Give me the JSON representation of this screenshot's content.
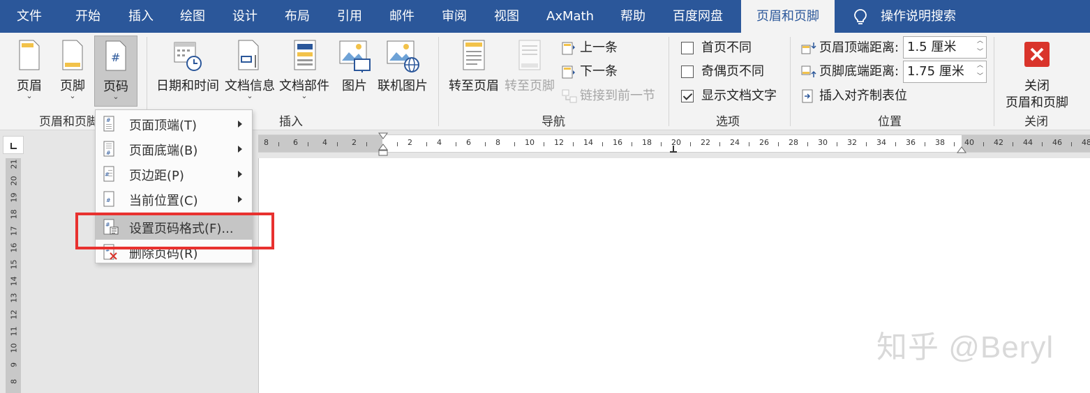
{
  "tabs": [
    {
      "label": "文件"
    },
    {
      "label": "开始"
    },
    {
      "label": "插入"
    },
    {
      "label": "绘图"
    },
    {
      "label": "设计"
    },
    {
      "label": "布局"
    },
    {
      "label": "引用"
    },
    {
      "label": "邮件"
    },
    {
      "label": "审阅"
    },
    {
      "label": "视图"
    },
    {
      "label": "AxMath"
    },
    {
      "label": "帮助"
    },
    {
      "label": "百度网盘"
    },
    {
      "label": "页眉和页脚"
    }
  ],
  "search": {
    "label": "操作说明搜索",
    "icon": "lightbulb-icon"
  },
  "ribbon": {
    "group_hf": {
      "label": "页眉和页脚",
      "header_btn": "页眉",
      "footer_btn": "页脚",
      "pagenum_btn": "页码",
      "pagenum_icon_text": "#"
    },
    "group_insert": {
      "label": "插入",
      "datetime": "日期和时间",
      "docinfo": "文档信息",
      "docparts": "文档部件",
      "picture": "图片",
      "onlinepic": "联机图片"
    },
    "group_nav": {
      "label": "导航",
      "goto_header": "转至页眉",
      "goto_footer": "转至页脚",
      "prev": "上一条",
      "next": "下一条",
      "link_prev": "链接到前一节"
    },
    "group_options": {
      "label": "选项",
      "diff_first": "首页不同",
      "diff_first_checked": false,
      "diff_oddeven": "奇偶页不同",
      "diff_oddeven_checked": false,
      "show_doc_text": "显示文档文字",
      "show_doc_text_checked": true
    },
    "group_position": {
      "label": "位置",
      "header_top": "页眉顶端距离:",
      "header_top_value": "1.5 厘米",
      "footer_bottom": "页脚底端距离:",
      "footer_bottom_value": "1.75 厘米",
      "insert_align_tab": "插入对齐制表位"
    },
    "group_close": {
      "label": "关闭",
      "close_btn_line1": "关闭",
      "close_btn_line2": "页眉和页脚",
      "close_color": "#d9342b"
    }
  },
  "ruler": {
    "left_numbers": [
      "8",
      "6",
      "4",
      "2"
    ],
    "right_numbers": [
      "2",
      "4",
      "6",
      "8",
      "10",
      "12",
      "14",
      "16",
      "18",
      "20",
      "22",
      "24",
      "26",
      "28",
      "30",
      "32",
      "34",
      "36",
      "38",
      "40",
      "42",
      "44",
      "46",
      "48"
    ],
    "vertical_numbers": [
      "21",
      "20",
      "19",
      "18",
      "17",
      "16",
      "15",
      "14",
      "13",
      "12",
      "11",
      "10",
      "9",
      "8"
    ]
  },
  "dropdown": {
    "items": [
      {
        "label": "页面顶端(T)",
        "has_submenu": true
      },
      {
        "label": "页面底端(B)",
        "has_submenu": true
      },
      {
        "label": "页边距(P)",
        "has_submenu": true
      },
      {
        "label": "当前位置(C)",
        "has_submenu": true
      },
      {
        "label": "设置页码格式(F)...",
        "has_submenu": false,
        "highlighted": true
      },
      {
        "label": "删除页码(R)",
        "has_submenu": false
      }
    ]
  },
  "watermark": "知乎 @Beryl",
  "colors": {
    "accent": "#2b579a",
    "highlight_box": "#e8312f"
  }
}
